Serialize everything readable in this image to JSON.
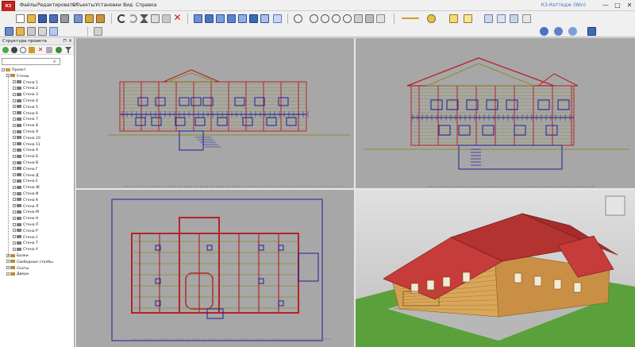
{
  "app": {
    "logo_text": "К3",
    "window_title": "К3-Коттедж (Win)",
    "menu": [
      "Файлы",
      "Редактировать",
      "Объекты",
      "Установки",
      "Вид",
      "Справка"
    ],
    "controls": {
      "minimize": "—",
      "maximize": "□",
      "close": "✕"
    }
  },
  "left_panel": {
    "title": "Структура проекта",
    "pin": "⊓ ×",
    "search": {
      "value": "",
      "placeholder": ""
    },
    "tree": {
      "root": "Проект",
      "walls_group": "Стены",
      "walls": [
        "Стена 1",
        "Стена 2",
        "Стена 3",
        "Стена 4",
        "Стена 5",
        "Стена 6",
        "Стена 7",
        "Стена 8",
        "Стена 9",
        "Стена 10",
        "Стена 11",
        "Стена А",
        "Стена Б",
        "Стена В",
        "Стена Г",
        "Стена Д",
        "Стена Е",
        "Стена Ж",
        "Стена И",
        "Стена К",
        "Стена Л",
        "Стена М",
        "Стена Н",
        "Стена П",
        "Стена Р",
        "Стена С",
        "Стена Т",
        "Стена У"
      ],
      "other_groups": [
        "Балки",
        "Свободные столбы",
        "Скаты",
        "Двери"
      ]
    }
  },
  "colors": {
    "accent": "#3c73c8",
    "roof": "#c63c3a",
    "log": "#d9a75a",
    "grass": "#5aa13b",
    "drawing_red": "#b5232a",
    "drawing_blue": "#1f1f9a",
    "drawing_olive": "#8c8c2e"
  },
  "icons": [
    "new-icon",
    "open-icon",
    "save-icon",
    "print-icon",
    "undo-icon",
    "redo-icon",
    "cut-icon",
    "copy-icon",
    "paste-icon",
    "delete-icon",
    "view-front-icon",
    "view-side-icon",
    "view-top-icon",
    "view-3d-icon",
    "zoom-icon",
    "pan-icon",
    "rotate-icon",
    "snap-icon",
    "layers-icon"
  ]
}
